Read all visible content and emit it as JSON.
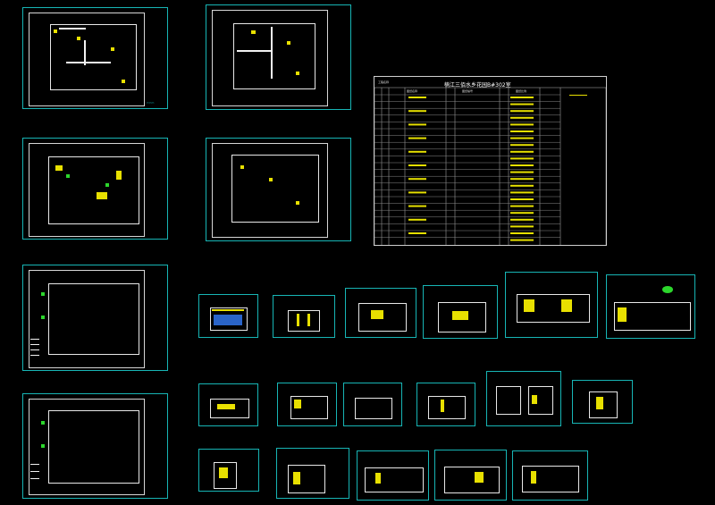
{
  "schedule": {
    "title": "楠江三佰水乡花园B#302室",
    "col_headers": [
      "工程名称",
      "图纸名称",
      "图纸编号",
      "图纸比例"
    ]
  }
}
